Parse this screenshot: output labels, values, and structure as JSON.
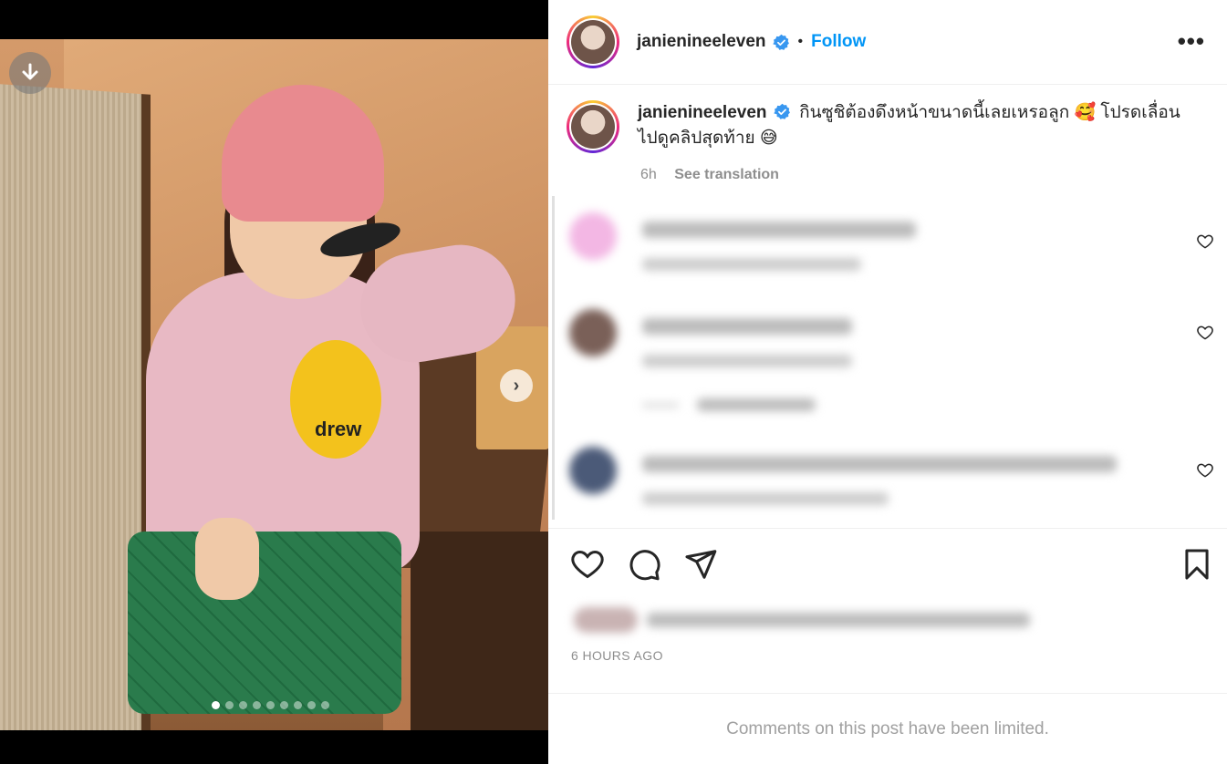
{
  "post": {
    "username": "janienineeleven",
    "follow_label": "Follow",
    "caption": "กินซูชิต้องดึงหน้าขนาดนี้เลยเหรอลูก 🥰 โปรดเลื่อนไปดูคลิปสุดท้าย 😅",
    "age": "6h",
    "see_translation": "See translation",
    "timestamp": "6 HOURS AGO",
    "comments_limited": "Comments on this post have been limited.",
    "carousel": {
      "total": 9,
      "current": 1
    }
  },
  "colors": {
    "accent": "#0095f6",
    "verified": "#3897f0"
  }
}
